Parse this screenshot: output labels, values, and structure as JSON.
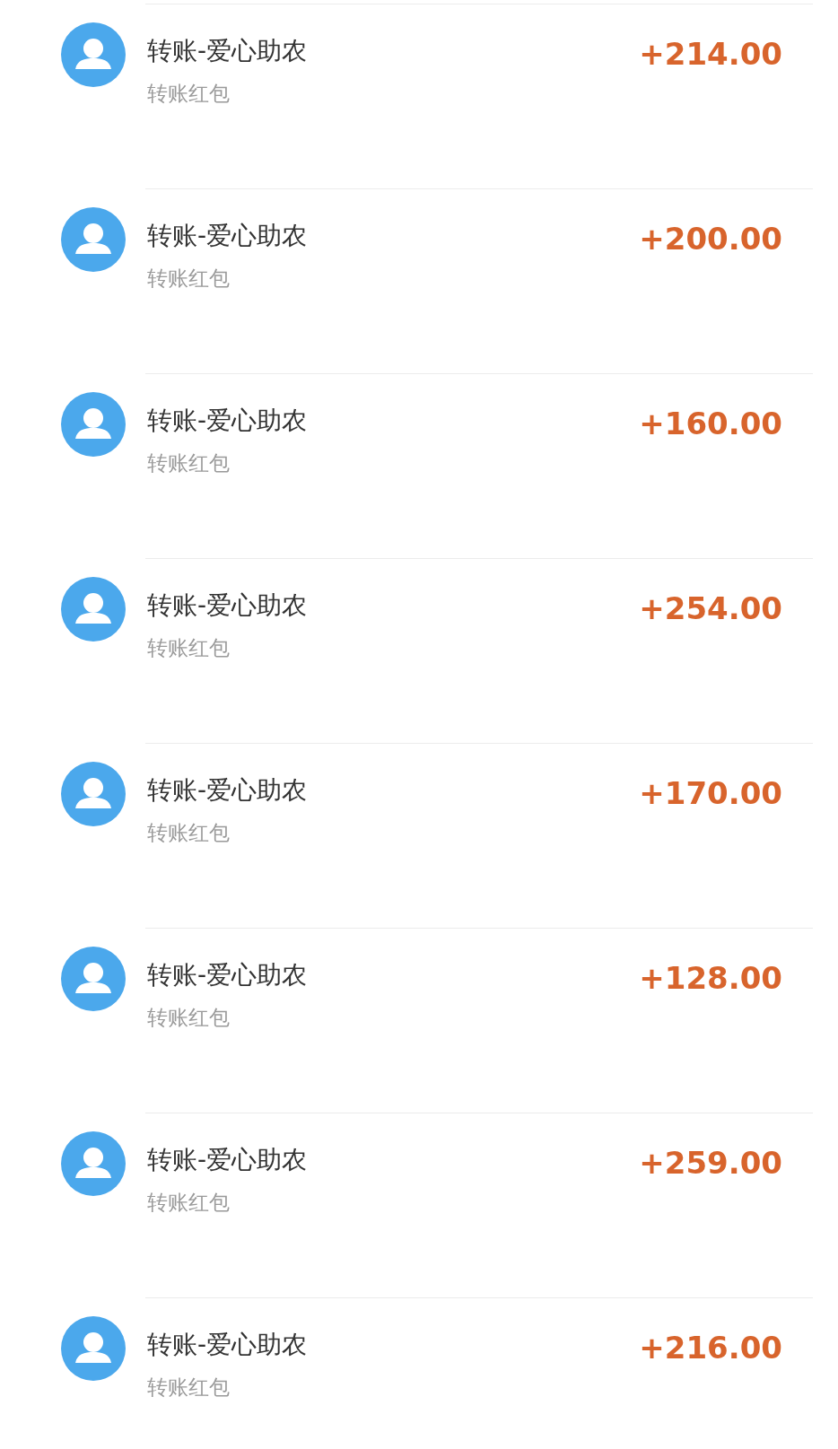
{
  "transactions": [
    {
      "title": "转账-爱心助农",
      "subtitle": "转账红包",
      "amount": "+214.00"
    },
    {
      "title": "转账-爱心助农",
      "subtitle": "转账红包",
      "amount": "+200.00"
    },
    {
      "title": "转账-爱心助农",
      "subtitle": "转账红包",
      "amount": "+160.00"
    },
    {
      "title": "转账-爱心助农",
      "subtitle": "转账红包",
      "amount": "+254.00"
    },
    {
      "title": "转账-爱心助农",
      "subtitle": "转账红包",
      "amount": "+170.00"
    },
    {
      "title": "转账-爱心助农",
      "subtitle": "转账红包",
      "amount": "+128.00"
    },
    {
      "title": "转账-爱心助农",
      "subtitle": "转账红包",
      "amount": "+259.00"
    },
    {
      "title": "转账-爱心助农",
      "subtitle": "转账红包",
      "amount": "+216.00"
    }
  ]
}
